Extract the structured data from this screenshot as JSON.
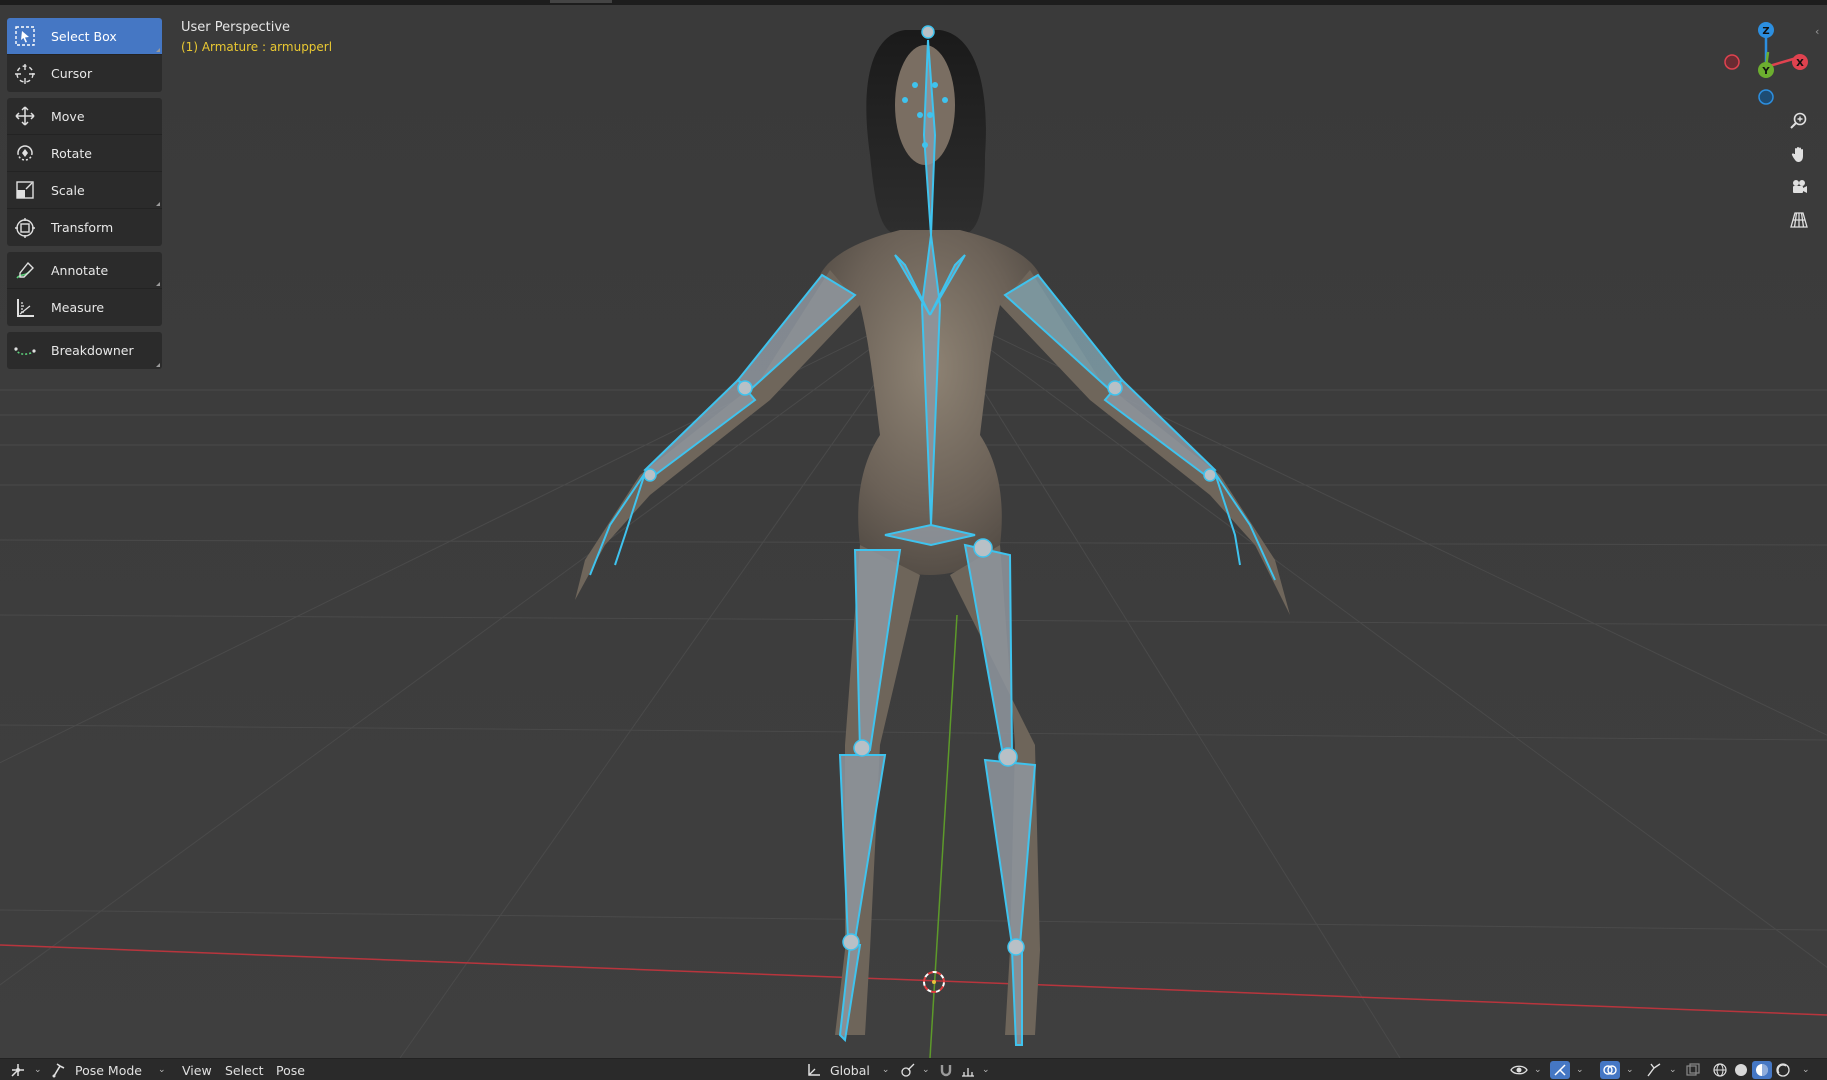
{
  "viewport": {
    "title": "User Perspective",
    "subtitle": "(1) Armature : armupperl"
  },
  "toolbar": {
    "tools": [
      {
        "label": "Select Box",
        "icon": "select-box-icon",
        "active": true
      },
      {
        "label": "Cursor",
        "icon": "cursor-icon"
      },
      {
        "label": "Move",
        "icon": "move-icon"
      },
      {
        "label": "Rotate",
        "icon": "rotate-icon"
      },
      {
        "label": "Scale",
        "icon": "scale-icon"
      },
      {
        "label": "Transform",
        "icon": "transform-icon"
      },
      {
        "label": "Annotate",
        "icon": "annotate-icon"
      },
      {
        "label": "Measure",
        "icon": "measure-icon"
      },
      {
        "label": "Breakdowner",
        "icon": "breakdowner-icon"
      }
    ]
  },
  "gizmo": {
    "z": "Z",
    "y": "Y",
    "x": "X"
  },
  "header": {
    "mode": "Pose Mode",
    "menus": [
      "View",
      "Select",
      "Pose"
    ],
    "orientation": "Global"
  },
  "colors": {
    "active_tool": "#4577c4",
    "bone": "#3fc3ee",
    "axis_x": "#e0424f",
    "axis_y": "#6cae2f",
    "axis_z": "#2c8fe0",
    "object_label": "#e9c832"
  }
}
